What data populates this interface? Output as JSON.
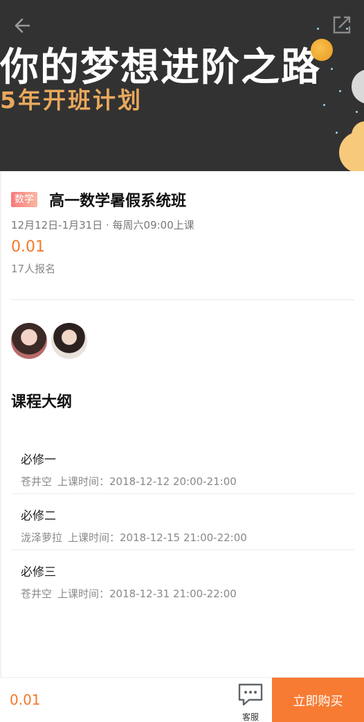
{
  "banner": {
    "headline": "你的梦想进阶之路",
    "subline": "5年开班计划"
  },
  "course": {
    "subject": "数学",
    "name": "高一数学暑假系统班",
    "schedule": "12月12日-1月31日 · 每周六09:00上课",
    "price": "0.01",
    "enrolled": "17人报名"
  },
  "outline": {
    "title": "课程大纲",
    "lessons": [
      {
        "name": "必修一",
        "teacher": "苍井空",
        "time": "上课时间：2018-12-12 20:00-21:00"
      },
      {
        "name": "必修二",
        "teacher": "泷泽萝拉",
        "time": "上课时间：2018-12-15 21:00-22:00"
      },
      {
        "name": "必修三",
        "teacher": "苍井空",
        "time": "上课时间：2018-12-31 21:00-22:00"
      }
    ]
  },
  "bottom_bar": {
    "price": "0.01",
    "service_label": "客服",
    "buy_label": "立即购买"
  },
  "colors": {
    "accent": "#f77b32",
    "price": "#f5782b",
    "banner_bg": "#323232",
    "banner_subline": "#e9a85d"
  },
  "icons": {
    "back": "arrow-left-icon",
    "share": "share-icon",
    "service": "chat-bubble-icon"
  }
}
